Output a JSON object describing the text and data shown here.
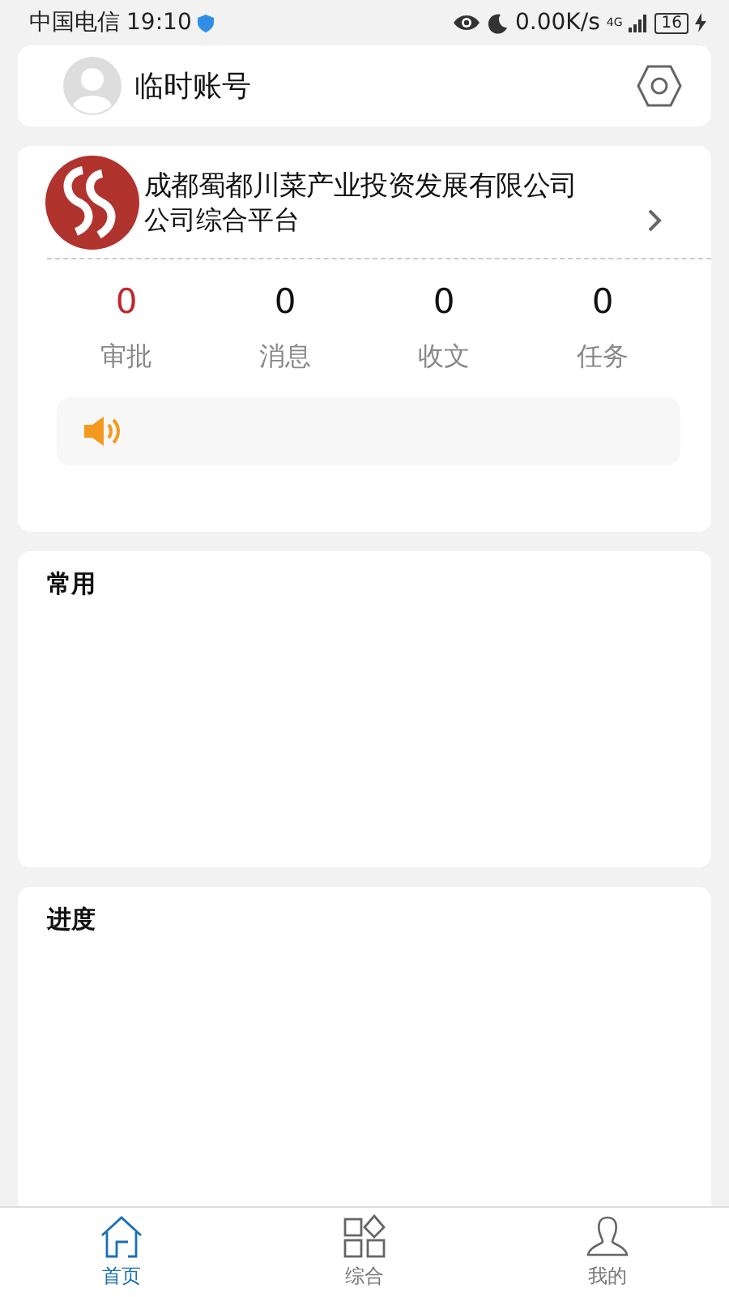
{
  "status_bar": {
    "carrier": "中国电信",
    "time": "19:10",
    "speed": "0.00K/s",
    "network": "4G",
    "battery": "16"
  },
  "account": {
    "name": "临时账号"
  },
  "company": {
    "name": "成都蜀都川菜产业投资发展有限公司",
    "subtitle": "公司综合平台"
  },
  "stats": [
    {
      "count": "0",
      "label": "审批",
      "color": "#c0282d"
    },
    {
      "count": "0",
      "label": "消息",
      "color": "#111111"
    },
    {
      "count": "0",
      "label": "收文",
      "color": "#111111"
    },
    {
      "count": "0",
      "label": "任务",
      "color": "#111111"
    }
  ],
  "sections": [
    {
      "title": "常用"
    },
    {
      "title": "进度"
    }
  ],
  "tabs": [
    {
      "label": "首页",
      "kind": "home",
      "selected": true
    },
    {
      "label": "综合",
      "kind": "grid",
      "selected": false
    },
    {
      "label": "我的",
      "kind": "person",
      "selected": false
    }
  ]
}
